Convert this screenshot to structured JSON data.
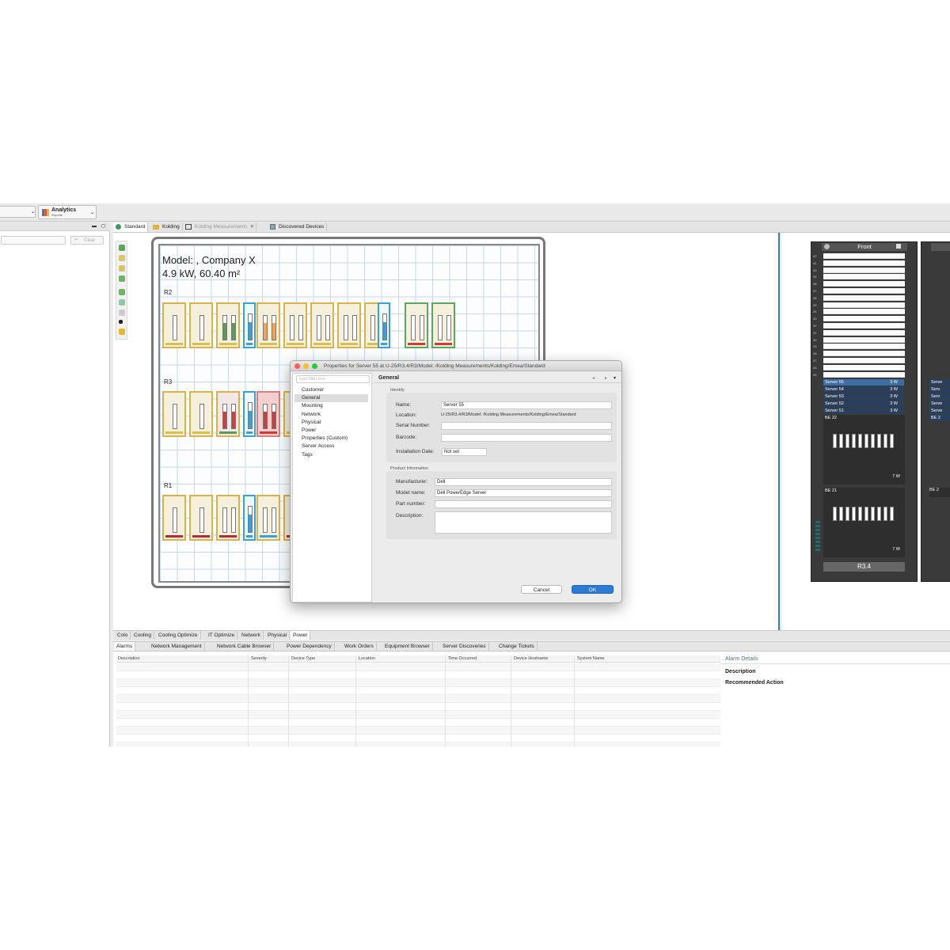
{
  "toolbar": {
    "analytics_title": "Analytics",
    "analytics_sub": "Reports",
    "clear_label": "Clear"
  },
  "editor_tabs": [
    {
      "label": "Standard",
      "icon": "globe-icon"
    },
    {
      "label": "Kolding",
      "icon": "folder-icon"
    },
    {
      "label": "Kolding Measurements",
      "icon": "floorplan-icon"
    },
    {
      "label": "Discovered Devices",
      "icon": "devices-icon"
    }
  ],
  "floorplan": {
    "model_line": "Model: ,  Company X",
    "power_line": "4.9 kW,   60.40 m²",
    "rows": [
      "R2",
      "R3",
      "R1"
    ]
  },
  "dialog": {
    "title": "Properties for Server 55 at U-25/R3.4/R3/Model: /Kolding Measurements/Kolding/Emea/Standard",
    "filter_placeholder": "type filter text",
    "nav": [
      "Customer",
      "General",
      "Mounting",
      "Network",
      "Physical",
      "Power",
      "Properties (Custom)",
      "Server Access",
      "Tags"
    ],
    "selected_nav": "General",
    "page_title": "General",
    "identify_legend": "Identify",
    "name_label": "Name:",
    "name_value": "Server 55",
    "location_label": "Location:",
    "location_value": "U-25/R3.4/R3/Model: /Kolding Measurements/Kolding/Emea/Standard",
    "serial_label": "Serial Number:",
    "serial_value": "",
    "barcode_label": "Barcode:",
    "barcode_value": "",
    "install_label": "Installation Date:",
    "install_value": "Not set",
    "product_legend": "Product Information",
    "manufacturer_label": "Manufacturer:",
    "manufacturer_value": "Dell",
    "model_label": "Model name:",
    "model_value": "Dell PowerEdge Server",
    "part_label": "Part number:",
    "part_value": "",
    "desc_label": "Description:",
    "desc_value": "",
    "cancel_label": "Cancel",
    "ok_label": "OK"
  },
  "rack_view": {
    "front_label": "Front",
    "rack_name": "R3.4",
    "units_top": [
      "42",
      "41",
      "40",
      "39",
      "38",
      "37",
      "36",
      "35",
      "34",
      "33",
      "32",
      "31",
      "30",
      "29",
      "28",
      "27",
      "26",
      "25"
    ],
    "servers": [
      {
        "u": "25",
        "name": "Server 55",
        "power": "3 W"
      },
      {
        "u": "24",
        "name": "Server 54",
        "power": "3 W"
      },
      {
        "u": "23",
        "name": "Server 53",
        "power": "3 W"
      },
      {
        "u": "22",
        "name": "Server 52",
        "power": "3 W"
      },
      {
        "u": "21",
        "name": "Server 51",
        "power": "3 W"
      }
    ],
    "be22": "BE 22",
    "be21": "BE 21",
    "be_power": "7 W",
    "be_power2": "7 W",
    "right_partial": [
      "Serve",
      "Serv",
      "Serv",
      "Serve",
      "Serve",
      "BE 2"
    ],
    "right_partial_b": "BE 2"
  },
  "bottom_tabs": [
    "Colo",
    "Cooling",
    "Cooling Optimize",
    "IT Optimize",
    "Network",
    "Physical",
    "Power"
  ],
  "bottom_active": "Power",
  "panel_tabs": [
    "Alarms",
    "Network Management",
    "Network Cable Browser",
    "Power Dependency",
    "Work Orders",
    "Equipment Browser",
    "Server Discoveries",
    "Change Tickets"
  ],
  "columns": [
    "Description",
    "Severity",
    "Device Type",
    "Location",
    "Time Occurred",
    "Device Hostname",
    "System Name"
  ],
  "alarm_details": {
    "title": "Alarm Details",
    "description_label": "Description",
    "action_label": "Recommended Action"
  },
  "colors": {
    "accent": "#2e7bd6",
    "selection": "#2a3f5c",
    "rack_border": "#d9b24a"
  }
}
